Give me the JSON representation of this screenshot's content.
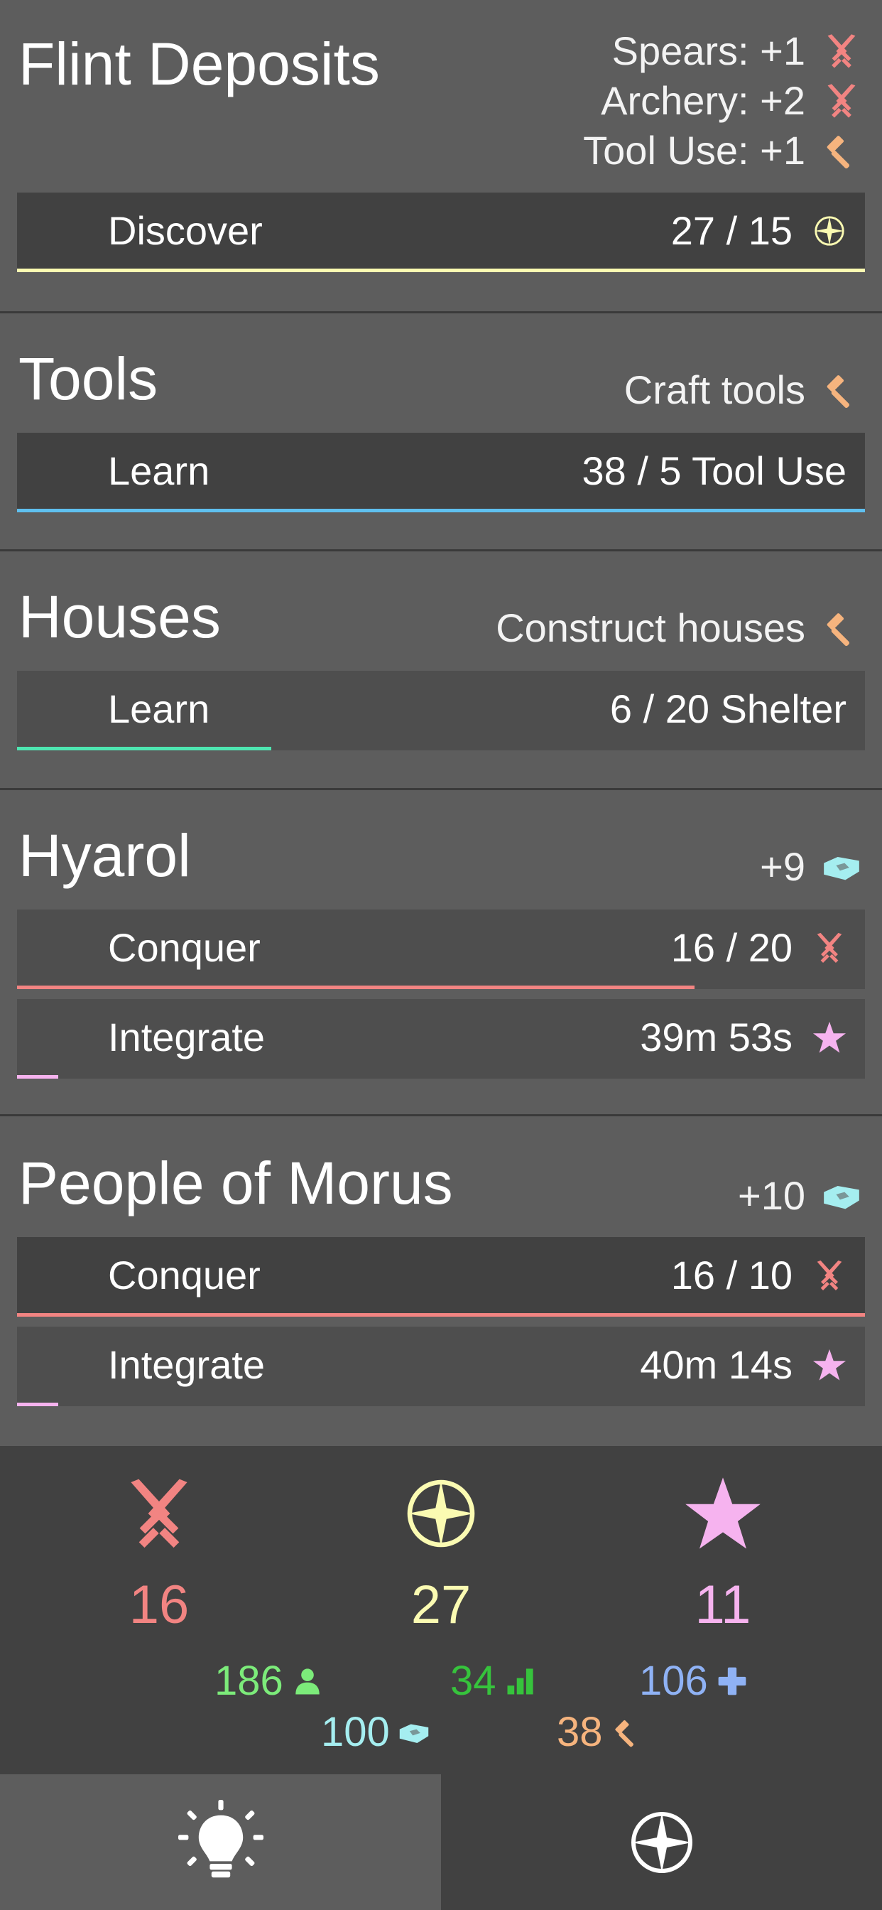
{
  "cards": {
    "flint": {
      "title": "Flint Deposits",
      "effects": [
        {
          "text": "Spears: +1",
          "icon": "crossed-swords-icon"
        },
        {
          "text": "Archery: +2",
          "icon": "crossed-swords-icon"
        },
        {
          "text": "Tool Use: +1",
          "icon": "hammer-icon"
        }
      ],
      "action": {
        "label": "Discover",
        "value": "27 / 15",
        "icon": "compass-icon",
        "progress": 1.0
      }
    },
    "tools": {
      "title": "Tools",
      "effect": {
        "text": "Craft tools",
        "icon": "hammer-icon"
      },
      "action": {
        "label": "Learn",
        "value": "38 / 5 Tool Use",
        "progress": 1.0
      }
    },
    "houses": {
      "title": "Houses",
      "effect": {
        "text": "Construct houses",
        "icon": "hammer-icon"
      },
      "action": {
        "label": "Learn",
        "value": "6 / 20 Shelter",
        "progress": 0.3
      }
    },
    "hyarol": {
      "title": "Hyarol",
      "effect": {
        "text": "+9",
        "icon": "land-icon"
      },
      "conquer": {
        "label": "Conquer",
        "value": "16 / 20",
        "icon": "crossed-swords-icon",
        "progress": 0.8
      },
      "integrate": {
        "label": "Integrate",
        "value": "39m 53s",
        "icon": "star-icon",
        "progress": 0.05
      }
    },
    "morus": {
      "title": "People of Morus",
      "effect": {
        "text": "+10",
        "icon": "land-icon"
      },
      "conquer": {
        "label": "Conquer",
        "value": "16 / 10",
        "icon": "crossed-swords-icon",
        "progress": 1.0
      },
      "integrate": {
        "label": "Integrate",
        "value": "40m 14s",
        "icon": "star-icon",
        "progress": 0.05
      }
    }
  },
  "stats": {
    "military": {
      "value": "16",
      "icon": "crossed-swords-icon"
    },
    "exploration": {
      "value": "27",
      "icon": "compass-icon"
    },
    "culture": {
      "value": "11",
      "icon": "star-icon"
    },
    "population": {
      "value": "186",
      "icon": "person-icon"
    },
    "growth": {
      "value": "34",
      "icon": "bar-chart-icon"
    },
    "health": {
      "value": "106",
      "icon": "plus-icon"
    },
    "land": {
      "value": "100",
      "icon": "land-icon"
    },
    "tools": {
      "value": "38",
      "icon": "hammer-icon"
    }
  },
  "tabs": [
    {
      "name": "ideas",
      "icon": "lightbulb-icon",
      "active": true
    },
    {
      "name": "explore",
      "icon": "compass-icon",
      "active": false
    }
  ],
  "colors": {
    "military": "#f28482",
    "exploration": "#fbfbb2",
    "culture": "#f6b3ef",
    "tools": "#f6b47e",
    "land": "#a5eef0",
    "learn_blue": "#5fc0ef",
    "learn_teal": "#4ee6b1",
    "population": "#7ceb7a",
    "growth": "#36c33c",
    "health": "#8fb2f5"
  }
}
